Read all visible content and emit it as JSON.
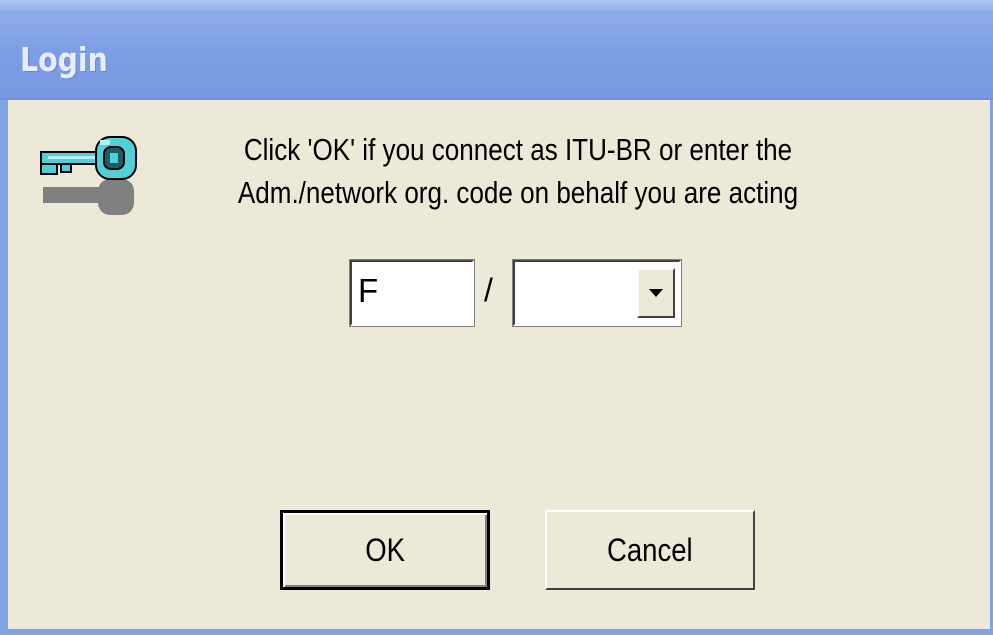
{
  "window": {
    "title": "Login"
  },
  "message": {
    "line1": "Click 'OK' if you connect as ITU-BR or enter the",
    "line2": "Adm./network org. code on behalf you are acting"
  },
  "code_input": {
    "value": "F",
    "separator": "/",
    "select_value": ""
  },
  "buttons": {
    "ok_label": "OK",
    "cancel_label": "Cancel"
  },
  "icons": {
    "key": "key-icon",
    "dropdown": "chevron-down-icon"
  },
  "colors": {
    "titlebar": "#7A99E0",
    "background": "#ECE9D8",
    "key": "#4FD0D6"
  }
}
